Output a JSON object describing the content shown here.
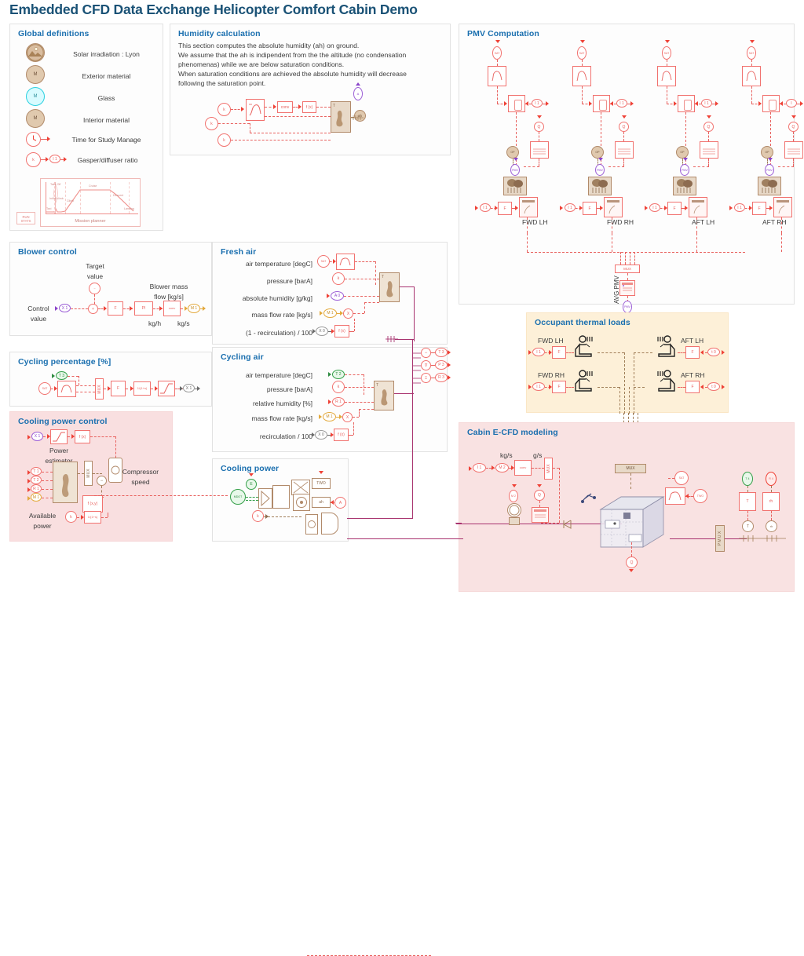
{
  "title": "Embedded CFD Data Exchange Helicopter Comfort Cabin Demo",
  "panels": {
    "global_definitions": {
      "title": "Global definitions",
      "items": [
        {
          "icon": "solar-irradiation-icon",
          "label": "Solar irradiation : Lyon"
        },
        {
          "icon": "exterior-material-icon",
          "label": "Exterior material"
        },
        {
          "icon": "glass-material-icon",
          "label": "Glass"
        },
        {
          "icon": "interior-material-icon",
          "label": "Interior material"
        },
        {
          "icon": "clock-icon",
          "label": "Time for Study Manage"
        },
        {
          "icon": "gasper-ratio-icon",
          "label": "Gasper/diffuser ratio"
        }
      ],
      "mission_planner": {
        "caption": "Mission planner",
        "run_stats": "RUN STATS",
        "phases": [
          "Taxi",
          "Take Off",
          "Initial climb",
          "Climb",
          "Cruise",
          "Descent",
          "Landing"
        ]
      }
    },
    "humidity_calculation": {
      "title": "Humidity calculation",
      "text_lines": [
        "This section computes the absolute humidity (ah) on ground.",
        "We assume that the ah is indipendent from the the altitude (no condensation",
        "phenomenas) while we are below saturation conditions.",
        "When saturation conditions are achieved the absolute humidity will decrease",
        "following the saturation point."
      ],
      "blocks": {
        "k1": "k",
        "k2": "k",
        "k3": "k",
        "fx": "f (x)",
        "ah": "ah",
        "T": "T"
      }
    },
    "pmv_computation": {
      "title": "PMV Computation",
      "columns": [
        "FWD LH",
        "FWD RH",
        "AFT LH",
        "AFT RH"
      ],
      "avg_label": "AVG PMV",
      "nodes": {
        "sat": "SAT",
        "i1": "I 1",
        "q": "Q",
        "mux": "MUX",
        "pmv": "PMV",
        "f": "F"
      }
    },
    "blower_control": {
      "title": "Blower control",
      "labels": {
        "control_value": "Control\nvalue",
        "target_value": "Target\nvalue",
        "blower_mass_flow": "Blower mass\nflow [kg/s]",
        "units_in": "kg/h",
        "units_out": "kg/s"
      },
      "blocks": {
        "x1": "X 1",
        "f": "F",
        "pi": "PI",
        "conv": "conv",
        "m1": "M 1"
      }
    },
    "cycling_percentage": {
      "title": "Cycling percentage [%]",
      "blocks": {
        "sat": "SAT",
        "t3": "T 3",
        "mux": "MUX",
        "f": "F",
        "frac": "1/(1+s)",
        "sat2": "sat",
        "x1": "X 1"
      }
    },
    "cooling_power_control": {
      "title": "Cooling power control",
      "labels": {
        "power_estimator": "Power\nestimator",
        "compressor_speed": "Compressor\nspeed",
        "available_power": "Available\npower"
      },
      "blocks": {
        "x1": "X 1",
        "fx": "f (x)",
        "fxy": "f (x,y)",
        "k": "k",
        "frac": "1/(1+s)"
      }
    },
    "fresh_air": {
      "title": "Fresh air",
      "rows": [
        "air temperature [degC]",
        "pressure [barA]",
        "absolute humidity [g/kg]",
        "mass flow rate [kg/s]",
        "(1 - recirculation) / 100"
      ],
      "blocks": {
        "sat": "SAT",
        "k": "k",
        "a0": "A 0",
        "m1": "M 1",
        "x0": "X 0",
        "fx": "f (x)",
        "mul": "X"
      }
    },
    "cycling_air": {
      "title": "Cycling air",
      "rows": [
        "air temperature [degC]",
        "pressure [barA]",
        "relative humidity [%]",
        "mass flow rate [kg/s]",
        "recirculation / 100"
      ],
      "blocks": {
        "t2": "T 2",
        "k": "k",
        "r1": "R 1",
        "m1": "M 1",
        "x0": "X 0",
        "fx": "f (x)",
        "mul": "X"
      },
      "outputs": [
        "T 3",
        "P 3",
        "R 3"
      ]
    },
    "cooling_power": {
      "title": "Cooling power",
      "blocks": {
        "mdot": "MDOT",
        "e": "E",
        "k": "k",
        "two": "TWO",
        "ah": "ah",
        "a": "A"
      }
    },
    "occupant_thermal_loads": {
      "title": "Occupant thermal loads",
      "seats": [
        "FWD LH",
        "FWD RH",
        "AFT LH",
        "AFT RH"
      ],
      "blocks": {
        "i1": "I 1",
        "f": "F",
        "t0": "t 0"
      }
    },
    "cabin_ecfd_modeling": {
      "title": "Cabin E-CFD modeling",
      "labels": {
        "kg_s": "kg/s",
        "g_s": "g/s"
      },
      "blocks": {
        "i1": "I 1",
        "m2": "M 2",
        "conv": "conv",
        "mux": "MUX",
        "q": "Q",
        "sat": "SAT",
        "two": "TWO",
        "pmux": "P M U X",
        "t": "T",
        "rh": "rh",
        "src": "Q",
        "node": "R"
      }
    }
  },
  "colors": {
    "title": "#1a5276",
    "panel_heading": "#1a6faf",
    "signal_red": "#ef4136",
    "block_red": "#f1726f",
    "magenta": "#a8336f",
    "brown": "#b18a6a",
    "green": "#35a04a",
    "purple": "#9c5fd6",
    "orange": "#e3a93c",
    "pink_bg": "#f9dfe0",
    "cream_bg": "#fdf0d8"
  }
}
